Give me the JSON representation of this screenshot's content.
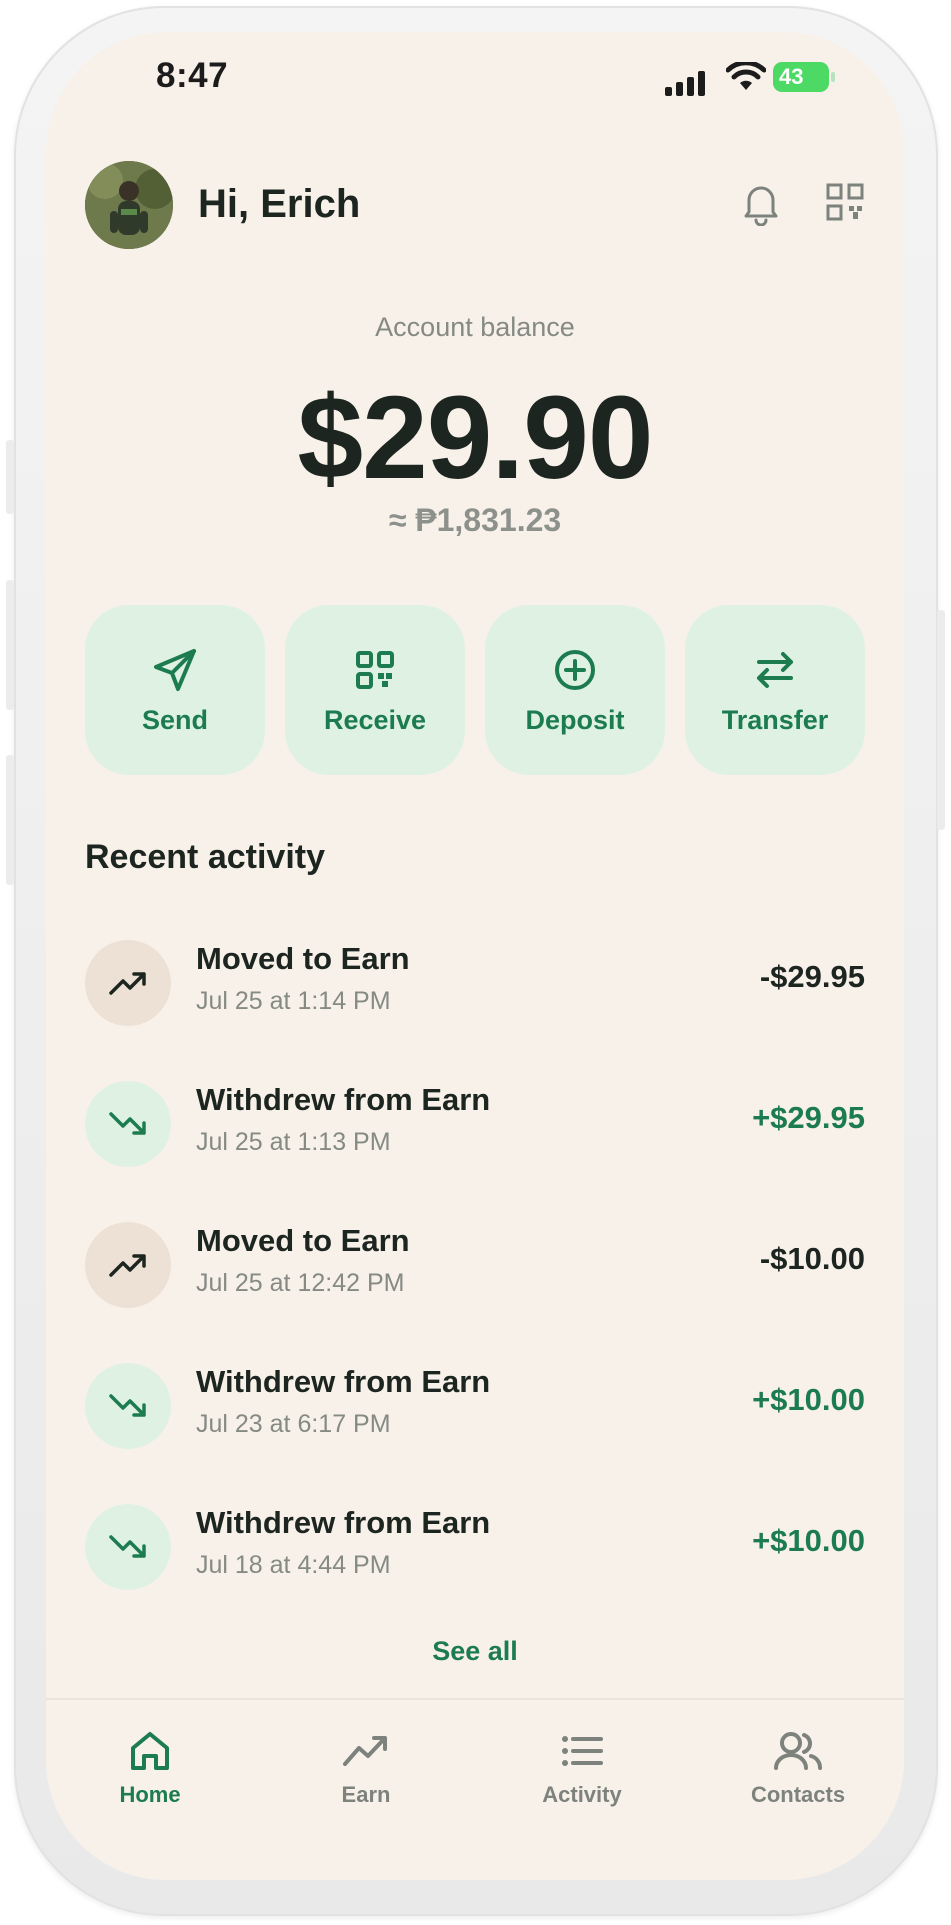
{
  "status_bar": {
    "time": "8:47",
    "battery": "43"
  },
  "header": {
    "greeting": "Hi, Erich",
    "avatar_icon": "user-avatar",
    "notification_icon": "bell-icon",
    "scan_icon": "qr-code-icon"
  },
  "balance": {
    "label": "Account balance",
    "amount": "$29.90",
    "converted": "≈ ₱1,831.23"
  },
  "actions": [
    {
      "label": "Send",
      "icon": "send-icon"
    },
    {
      "label": "Receive",
      "icon": "qr-code-icon"
    },
    {
      "label": "Deposit",
      "icon": "plus-circle-icon"
    },
    {
      "label": "Transfer",
      "icon": "transfer-arrows-icon"
    }
  ],
  "recent_activity": {
    "title": "Recent activity",
    "items": [
      {
        "title": "Moved to Earn",
        "date": "Jul 25 at 1:14 PM",
        "amount": "-$29.95",
        "direction": "out"
      },
      {
        "title": "Withdrew from Earn",
        "date": "Jul 25 at 1:13 PM",
        "amount": "+$29.95",
        "direction": "in"
      },
      {
        "title": "Moved to Earn",
        "date": "Jul 25 at 12:42 PM",
        "amount": "-$10.00",
        "direction": "out"
      },
      {
        "title": "Withdrew from Earn",
        "date": "Jul 23 at 6:17 PM",
        "amount": "+$10.00",
        "direction": "in"
      },
      {
        "title": "Withdrew from Earn",
        "date": "Jul 18 at 4:44 PM",
        "amount": "+$10.00",
        "direction": "in"
      }
    ],
    "see_all": "See all"
  },
  "tabs": [
    {
      "label": "Home",
      "icon": "home-icon",
      "active": true
    },
    {
      "label": "Earn",
      "icon": "trending-up-icon",
      "active": false
    },
    {
      "label": "Activity",
      "icon": "list-icon",
      "active": false
    },
    {
      "label": "Contacts",
      "icon": "users-icon",
      "active": false
    }
  ],
  "colors": {
    "background": "#f8f1ea",
    "accent": "#1d7c4f",
    "action_bg": "#dff1e3",
    "text": "#1d2520",
    "muted": "#858a83"
  }
}
